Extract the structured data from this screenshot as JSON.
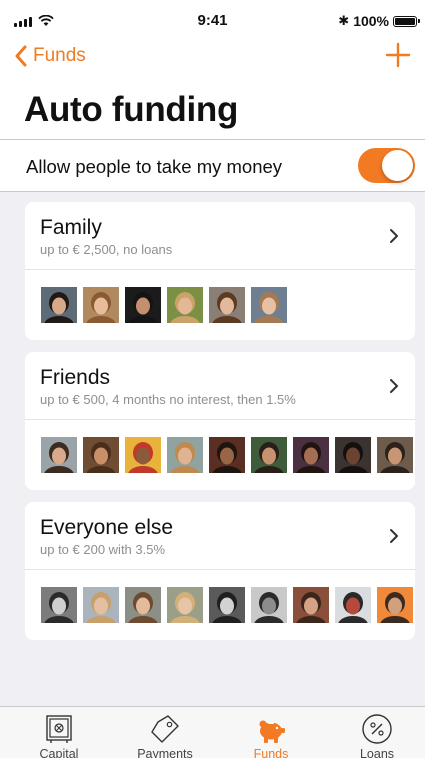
{
  "status_bar": {
    "time": "9:41",
    "battery": "100%"
  },
  "nav": {
    "back_label": "Funds",
    "back_icon": "chevron-left-icon",
    "add_icon": "plus-icon"
  },
  "page": {
    "title": "Auto funding"
  },
  "toggle": {
    "label": "Allow people to take my money",
    "on": true
  },
  "groups": [
    {
      "title": "Family",
      "subtitle": "up to € 2,500, no loans",
      "avatars": [
        {
          "bg": "#5d6b76",
          "skin": "#d7a98a",
          "hair": "#1f1a17"
        },
        {
          "bg": "#b08a5e",
          "skin": "#e6bd98",
          "hair": "#8a5a34"
        },
        {
          "bg": "#1b1b1b",
          "skin": "#c58f6e",
          "hair": "#141414"
        },
        {
          "bg": "#7b8f45",
          "skin": "#e2b896",
          "hair": "#c9a36a"
        },
        {
          "bg": "#8a7f75",
          "skin": "#e3b99d",
          "hair": "#5c3b24"
        },
        {
          "bg": "#6f7f92",
          "skin": "#e6c1a6",
          "hair": "#a57a52"
        }
      ]
    },
    {
      "title": "Friends",
      "subtitle": "up to € 500, 4 months no interest, then 1.5%",
      "avatars": [
        {
          "bg": "#9aa4a8",
          "skin": "#d8a98a",
          "hair": "#3b2b20"
        },
        {
          "bg": "#6e4d33",
          "skin": "#c88f69",
          "hair": "#4a2e1c"
        },
        {
          "bg": "#e8b23b",
          "skin": "#8a5a3b",
          "hair": "#c0392b"
        },
        {
          "bg": "#8fa3a1",
          "skin": "#e0b393",
          "hair": "#c08a4f"
        },
        {
          "bg": "#5a2e22",
          "skin": "#9a6447",
          "hair": "#1e1410"
        },
        {
          "bg": "#3e5b3a",
          "skin": "#c79270",
          "hair": "#2a1f18"
        },
        {
          "bg": "#4a3040",
          "skin": "#a56d53",
          "hair": "#20140f"
        },
        {
          "bg": "#3a3330",
          "skin": "#6a4331",
          "hair": "#151010"
        },
        {
          "bg": "#6d5b4c",
          "skin": "#c89575",
          "hair": "#2c221b"
        }
      ]
    },
    {
      "title": "Everyone else",
      "subtitle": "up to € 200 with 3.5%",
      "avatars": [
        {
          "bg": "#7c7c7c",
          "skin": "#cfcfcf",
          "hair": "#2a2a2a"
        },
        {
          "bg": "#a9b4bc",
          "skin": "#e4bfa2",
          "hair": "#c9a06b"
        },
        {
          "bg": "#8c8f86",
          "skin": "#e2bb9b",
          "hair": "#6e4a30"
        },
        {
          "bg": "#9c9f88",
          "skin": "#e6c4a8",
          "hair": "#d2b07a"
        },
        {
          "bg": "#5a5a5a",
          "skin": "#d2d2d2",
          "hair": "#1f1f1f"
        },
        {
          "bg": "#c9c9c9",
          "skin": "#8c8c8c",
          "hair": "#2b2b2b"
        },
        {
          "bg": "#8a4f3a",
          "skin": "#d6a283",
          "hair": "#3a261a"
        },
        {
          "bg": "#d9dde0",
          "skin": "#b54a3c",
          "hair": "#2a2a2a"
        },
        {
          "bg": "#f08a3a",
          "skin": "#d3a07c",
          "hair": "#3b2a20"
        }
      ]
    }
  ],
  "tabs": [
    {
      "label": "Capital",
      "icon": "safe-icon"
    },
    {
      "label": "Payments",
      "icon": "tag-icon"
    },
    {
      "label": "Funds",
      "icon": "piggy-bank-icon"
    },
    {
      "label": "Loans",
      "icon": "percent-icon"
    }
  ],
  "colors": {
    "accent": "#f27a22",
    "background": "#efeff4",
    "text": "#111111",
    "secondary_text": "#8e8e93"
  }
}
